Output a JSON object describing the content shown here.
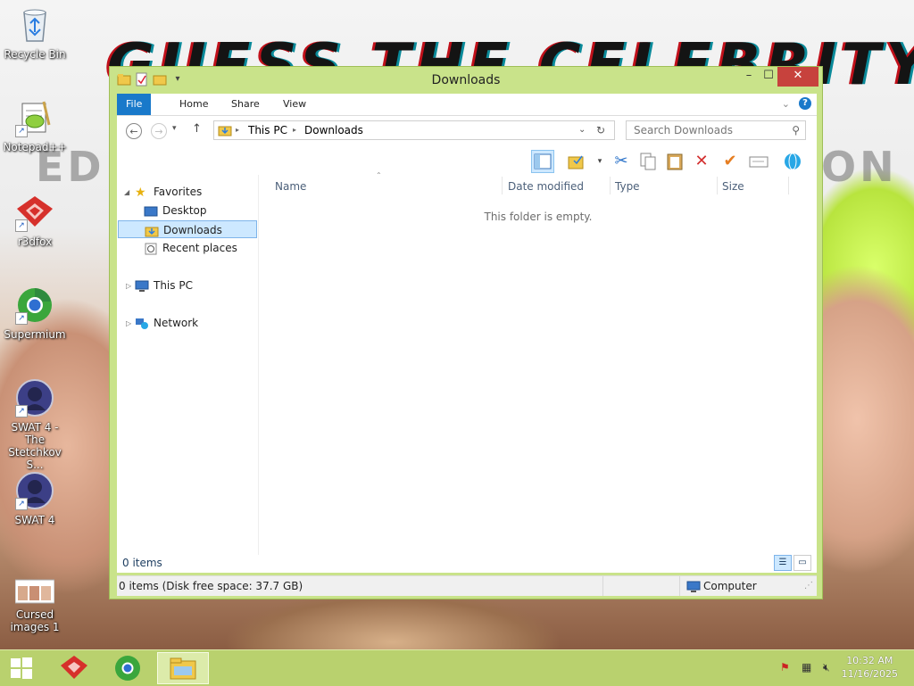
{
  "desktop": {
    "background_title": "GUESS THE CELEBRITY",
    "background_sub_left": "ED S",
    "background_sub_right": "ON M",
    "icons": [
      {
        "label": "Recycle Bin",
        "icon": "recycle-bin-icon"
      },
      {
        "label": "Notepad++",
        "icon": "notepad-plus-plus-icon"
      },
      {
        "label": "r3dfox",
        "icon": "r3dfox-browser-icon"
      },
      {
        "label": "Supermium",
        "icon": "supermium-browser-icon"
      },
      {
        "label": "SWAT 4 - The Stetchkov S...",
        "icon": "swat4-game-icon"
      },
      {
        "label": "SWAT 4",
        "icon": "swat4-game-icon"
      },
      {
        "label": "Cursed images 1",
        "icon": "image-file-icon"
      }
    ]
  },
  "window": {
    "title": "Downloads",
    "controls": {
      "minimize": "–",
      "maximize": "☐",
      "close": "✕"
    },
    "ribbon_tabs": [
      "File",
      "Home",
      "Share",
      "View"
    ],
    "help": "?",
    "address": {
      "root": "This PC",
      "current": "Downloads"
    },
    "search_placeholder": "Search Downloads",
    "nav_pane": {
      "favorites": "Favorites",
      "favorites_items": [
        "Desktop",
        "Downloads",
        "Recent places"
      ],
      "this_pc": "This PC",
      "network": "Network"
    },
    "columns": [
      "Name",
      "Date modified",
      "Type",
      "Size"
    ],
    "empty_message": "This folder is empty.",
    "item_count": "0 items",
    "status_left": "0 items (Disk free space: 37.7 GB)",
    "status_right": "Computer"
  },
  "taskbar": {
    "time": "10:32 AM",
    "date": "11/16/2025"
  },
  "colors": {
    "window_frame": "#c9e38a",
    "file_tab": "#1979ca",
    "close_button": "#c7423d",
    "selection": "#cde8ff",
    "taskbar": "#b9d16e"
  }
}
